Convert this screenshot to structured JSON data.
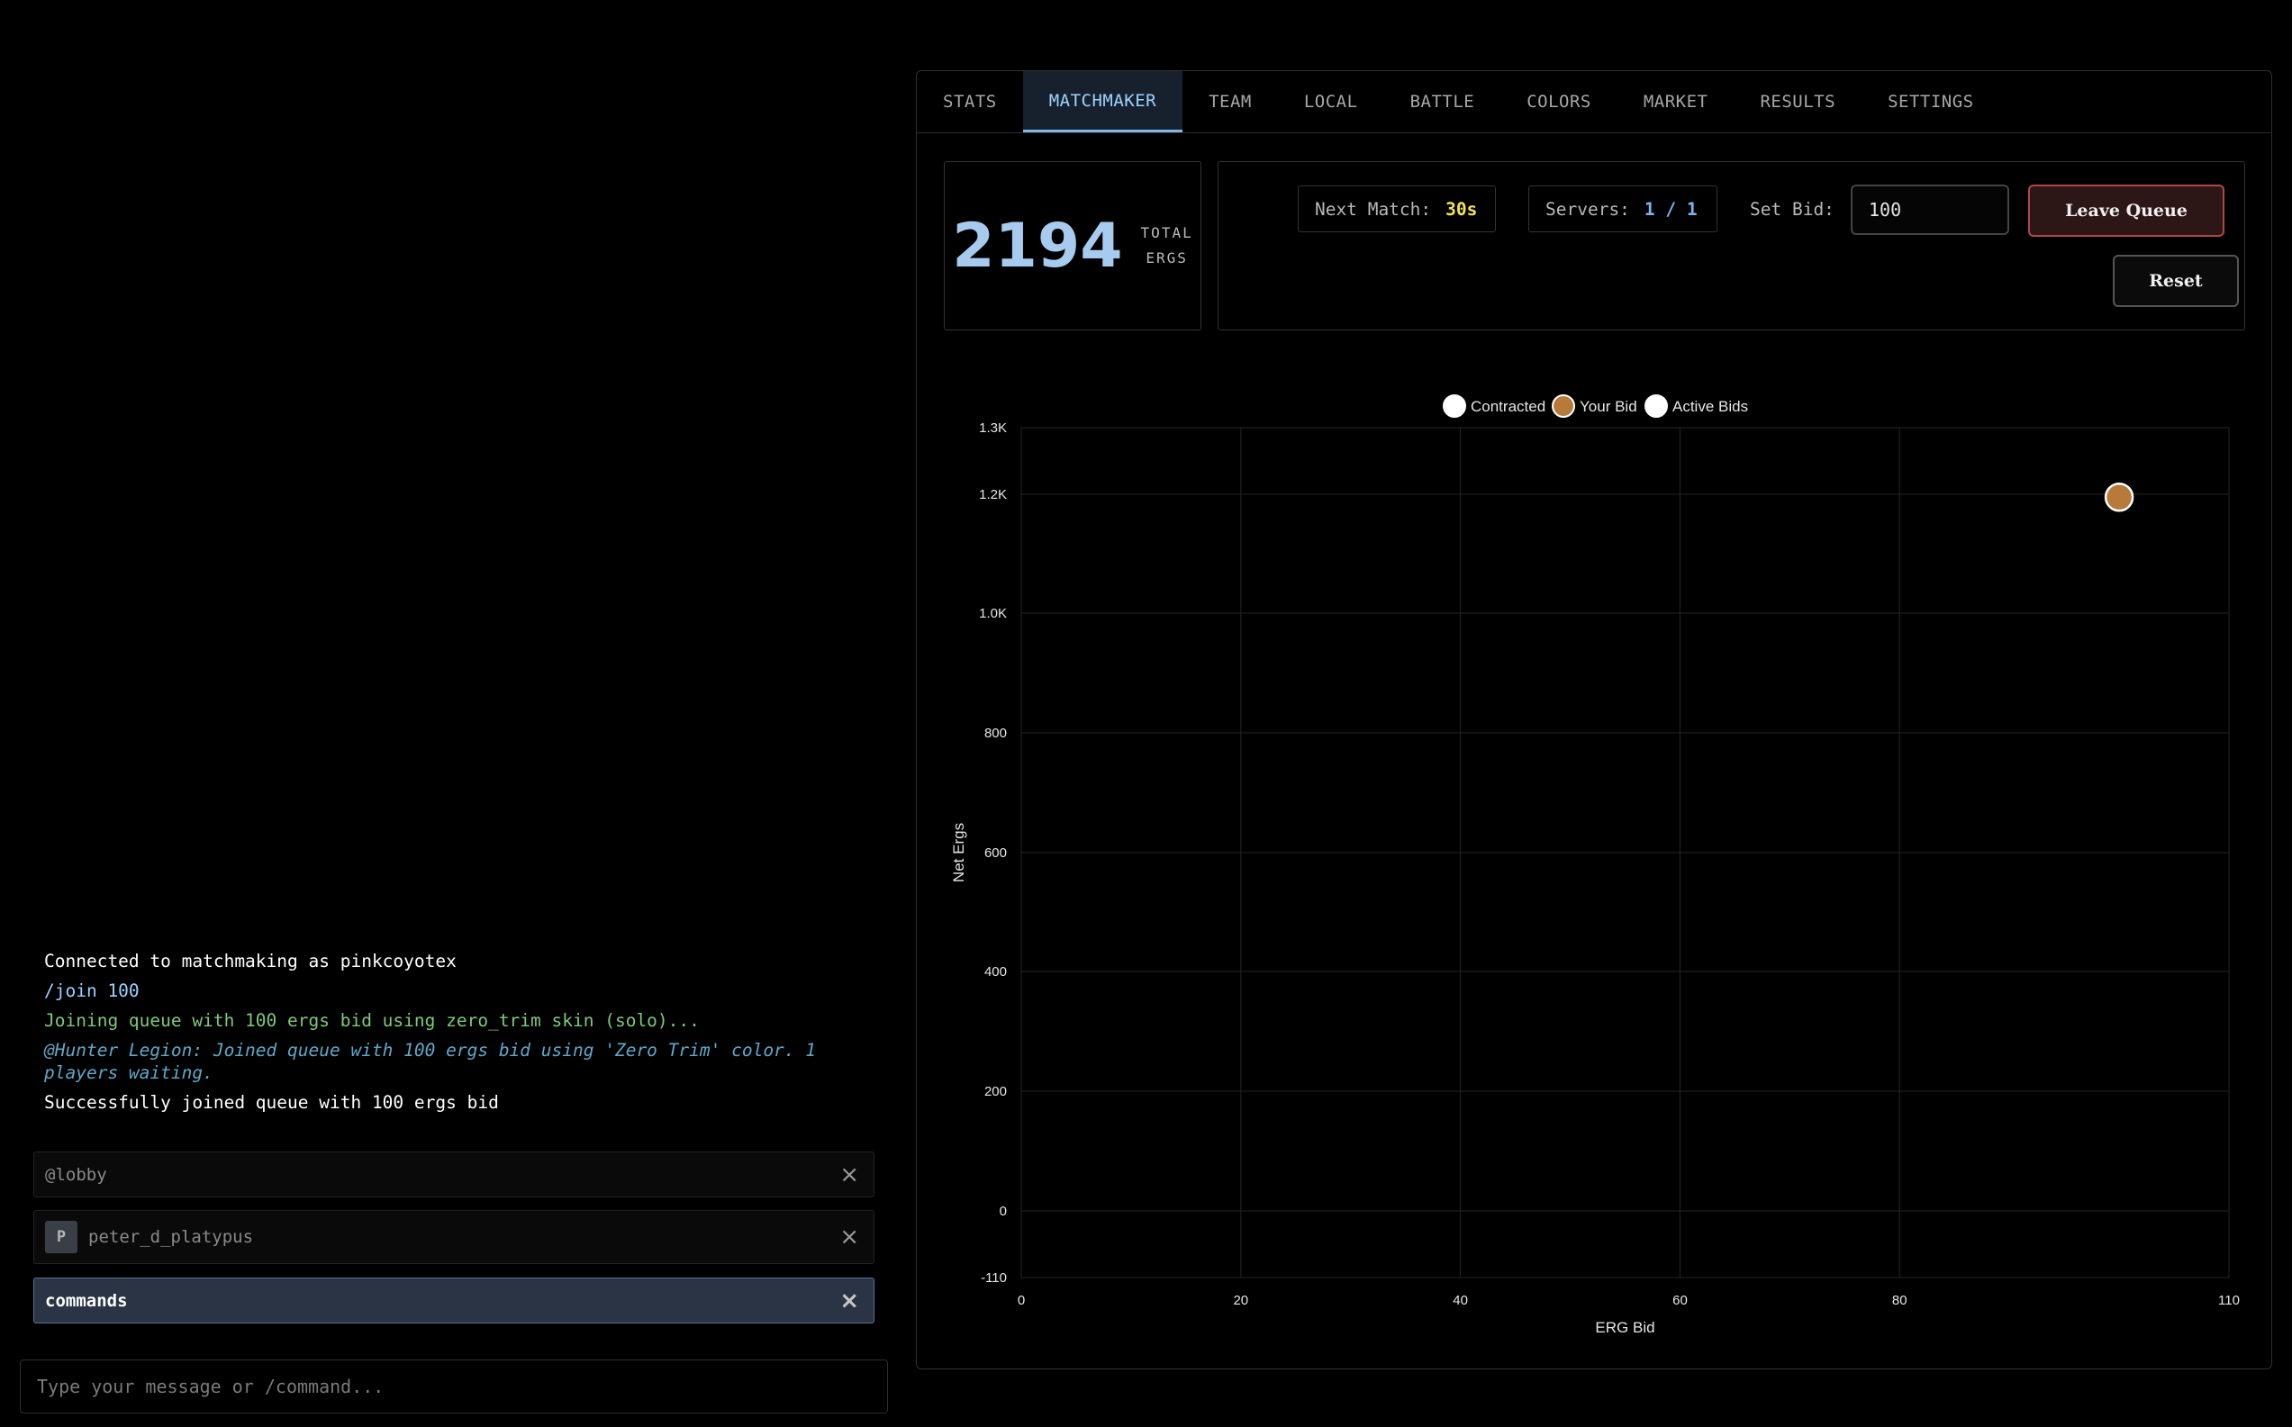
{
  "chat": {
    "messages": [
      {
        "type": "system",
        "text": "Connected to matchmaking as pinkcoyotex"
      },
      {
        "type": "command",
        "text": "/join 100"
      },
      {
        "type": "joining",
        "text": "Joining queue with 100 ergs bid using zero_trim skin (solo)..."
      },
      {
        "type": "notice",
        "text": "@Hunter Legion: Joined queue with 100 ergs bid using 'Zero Trim' color. 1 players waiting."
      },
      {
        "type": "success",
        "text": "Successfully joined queue with 100 ergs bid"
      }
    ],
    "channels": {
      "lobby": {
        "label": "@lobby"
      },
      "peter": {
        "avatar": "P",
        "label": "peter_d_platypus"
      },
      "commands": {
        "label": "commands"
      }
    },
    "close_glyph": "×",
    "input_placeholder": "Type your message or /command..."
  },
  "tabs": [
    "STATS",
    "MATCHMAKER",
    "TEAM",
    "LOCAL",
    "BATTLE",
    "COLORS",
    "MARKET",
    "RESULTS",
    "SETTINGS"
  ],
  "active_tab": "MATCHMAKER",
  "ergs": {
    "value": "2194",
    "unit_line1": "TOTAL",
    "unit_line2": "ERGS"
  },
  "matchmaker": {
    "next_match_label": "Next Match:",
    "next_match_value": "30s",
    "servers_label": "Servers:",
    "servers_value": "1 / 1",
    "set_bid_label": "Set Bid:",
    "bid_value": "100",
    "leave_label": "Leave Queue",
    "reset_label": "Reset"
  },
  "colors": {
    "accent": "#7fb8e6",
    "your_bid": "#b87a3a",
    "danger": "#b0474c"
  },
  "chart_data": {
    "type": "scatter",
    "xlabel": "ERG Bid",
    "ylabel": "Net Ergs",
    "xlim": [
      0,
      110
    ],
    "ylim": [
      -110,
      1300
    ],
    "x_ticks": [
      {
        "v": 0,
        "label": "0"
      },
      {
        "v": 20,
        "label": "20"
      },
      {
        "v": 40,
        "label": "40"
      },
      {
        "v": 60,
        "label": "60"
      },
      {
        "v": 80,
        "label": "80"
      },
      {
        "v": 110,
        "label": "110"
      }
    ],
    "y_ticks": [
      {
        "v": -110,
        "label": "-110"
      },
      {
        "v": 0,
        "label": "0"
      },
      {
        "v": 200,
        "label": "200"
      },
      {
        "v": 400,
        "label": "400"
      },
      {
        "v": 600,
        "label": "600"
      },
      {
        "v": 800,
        "label": "800"
      },
      {
        "v": 1000,
        "label": "1.0K"
      },
      {
        "v": 1200,
        "label": "1.2K"
      },
      {
        "v": 1300,
        "label": "1.3K"
      }
    ],
    "legend_position": "top-center",
    "grid": true,
    "series": [
      {
        "name": "Contracted",
        "color": "#ffffff",
        "points": []
      },
      {
        "name": "Your Bid",
        "color": "#b87a3a",
        "points": [
          {
            "x": 100,
            "y": 1195
          }
        ]
      },
      {
        "name": "Active Bids",
        "color": "#ffffff",
        "points": []
      }
    ]
  }
}
